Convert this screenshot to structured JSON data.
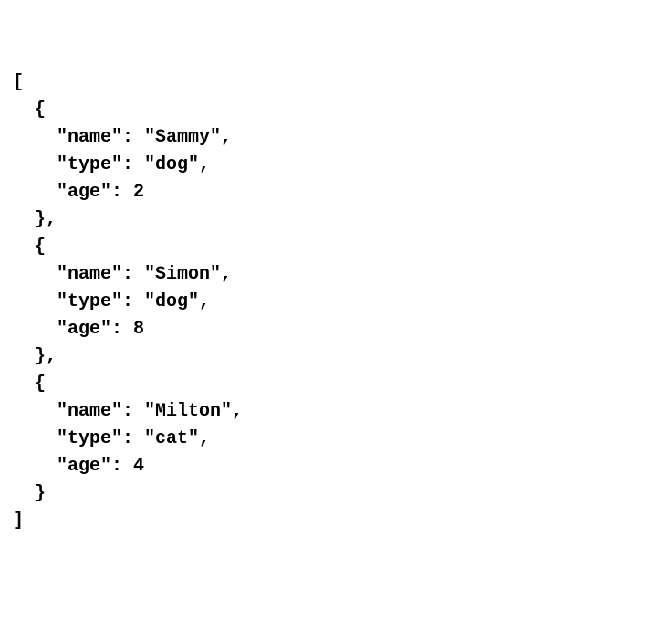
{
  "code": {
    "line01": "[",
    "line02": "  {",
    "line03": "    \"name\": \"Sammy\",",
    "line04": "    \"type\": \"dog\",",
    "line05": "    \"age\": 2",
    "line06": "  },",
    "line07": "  {",
    "line08": "    \"name\": \"Simon\",",
    "line09": "    \"type\": \"dog\",",
    "line10": "    \"age\": 8",
    "line11": "  },",
    "line12": "  {",
    "line13": "    \"name\": \"Milton\",",
    "line14": "    \"type\": \"cat\",",
    "line15": "    \"age\": 4",
    "line16": "  }",
    "line17": "]"
  }
}
